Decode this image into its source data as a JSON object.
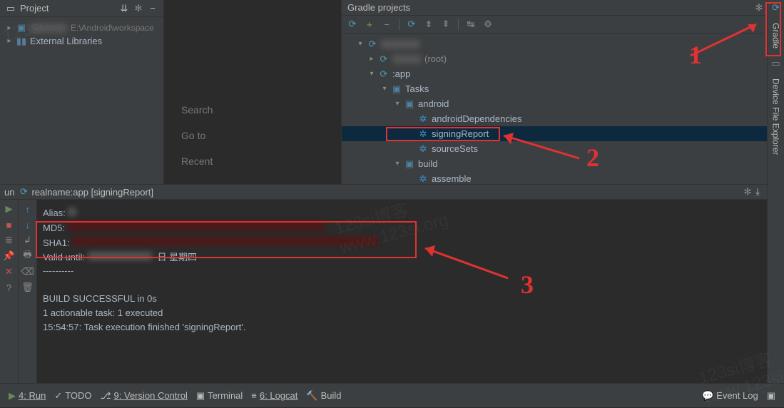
{
  "projectPanel": {
    "title": "Project",
    "root": "E:\\Android\\workspace",
    "extLib": "External Libraries"
  },
  "center": {
    "search": "Search",
    "goto": "Go to",
    "recent": "Recent"
  },
  "gradle": {
    "title": "Gradle projects",
    "rootProject": "(root)",
    "app": ":app",
    "tasks": "Tasks",
    "groups": {
      "android": "android",
      "build": "build"
    },
    "tasksAndroid": {
      "androidDependencies": "androidDependencies",
      "signingReport": "signingReport",
      "sourceSets": "sourceSets"
    },
    "tasksBuild": {
      "assemble": "assemble"
    }
  },
  "rightBar": {
    "gradle": "Gradle",
    "deviceExplorer": "Device File Explorer"
  },
  "run": {
    "tabPrefix": "un",
    "procIcon": "●",
    "procName": "realname:app [signingReport]",
    "lines": {
      "alias": "Alias: ",
      "aliasVal": "*",
      "md5": "MD5: ",
      "md5Val": "                                        ",
      "sha1": "SHA1: ",
      "sha1Val": "                                              ",
      "validUntil": "Valid until: ",
      "validUntilVal": "          ",
      "validUntilSuffix": "日 星期四",
      "dash": "----------",
      "success": "BUILD SUCCESSFUL in 0s",
      "actionable": "1 actionable task: 1 executed",
      "finished": "15:54:57: Task execution finished 'signingReport'."
    }
  },
  "bottom": {
    "run": "4: Run",
    "todo": "TODO",
    "vcs": "9: Version Control",
    "terminal": "Terminal",
    "logcat": "6: Logcat",
    "build": "Build",
    "eventLog": "Event Log"
  },
  "annotations": {
    "n1": "1",
    "n2": "2",
    "n3": "3"
  }
}
